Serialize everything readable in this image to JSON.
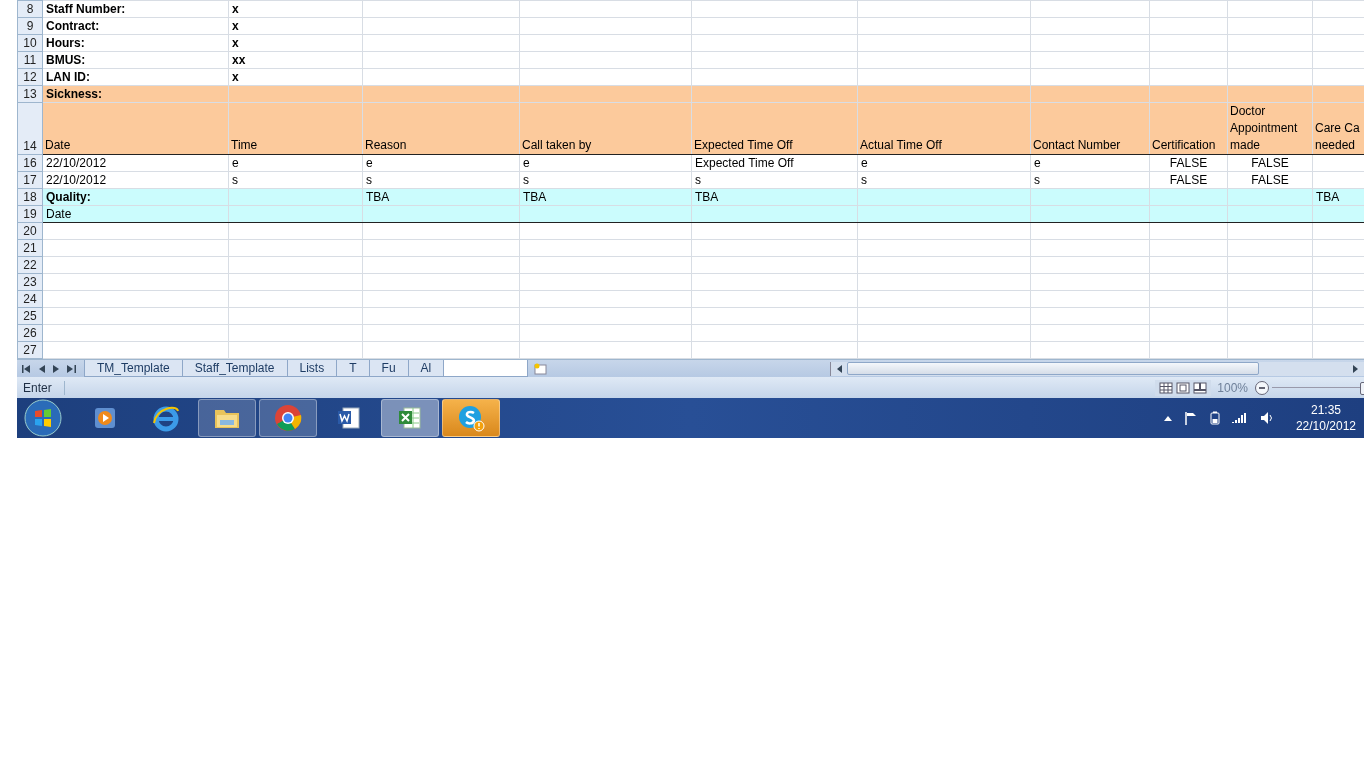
{
  "rows": [
    {
      "number": "8",
      "kind": "info",
      "cells": [
        "Staff Number:",
        "x"
      ]
    },
    {
      "number": "9",
      "kind": "info",
      "cells": [
        "Contract:",
        "x"
      ]
    },
    {
      "number": "10",
      "kind": "info",
      "cells": [
        "Hours:",
        "x"
      ]
    },
    {
      "number": "11",
      "kind": "info",
      "cells": [
        "BMUS:",
        "xx"
      ]
    },
    {
      "number": "12",
      "kind": "info",
      "cells": [
        "LAN ID:",
        "x"
      ]
    },
    {
      "number": "13",
      "kind": "section",
      "color": "#fcca9c",
      "cells": [
        "Sickness:"
      ]
    },
    {
      "number": "14",
      "kind": "header",
      "color": "#fcca9c",
      "cells": [
        "Date",
        "Time",
        "Reason",
        "Call taken by",
        "Expected Time Off",
        "Actual Time Off",
        "Contact Number",
        "Certification",
        "Doctor Appointment made",
        "Care Ca needed"
      ]
    },
    {
      "number": "16",
      "kind": "data",
      "cells": [
        "22/10/2012",
        "e",
        "e",
        "e",
        "Expected Time Off",
        "e",
        "e",
        "FALSE",
        "FALSE"
      ]
    },
    {
      "number": "17",
      "kind": "data",
      "cells": [
        "22/10/2012",
        "s",
        "s",
        "s",
        "s",
        "s",
        "s",
        "FALSE",
        "FALSE"
      ]
    },
    {
      "number": "18",
      "kind": "section",
      "color": "#cbfcfd",
      "cells": [
        "Quality:",
        null,
        "TBA",
        "TBA",
        "TBA",
        null,
        null,
        null,
        null,
        "TBA"
      ]
    },
    {
      "number": "19",
      "kind": "data",
      "color": "#cbfcfd",
      "cells": [
        "Date"
      ]
    },
    {
      "number": "20",
      "kind": "data"
    },
    {
      "number": "21",
      "kind": "data"
    },
    {
      "number": "22",
      "kind": "data"
    },
    {
      "number": "23",
      "kind": "data"
    },
    {
      "number": "24",
      "kind": "data"
    },
    {
      "number": "25",
      "kind": "data"
    },
    {
      "number": "26",
      "kind": "data"
    },
    {
      "number": "27",
      "kind": "data"
    }
  ],
  "sheet_tabs": [
    {
      "label": "TM_Template",
      "selected": false
    },
    {
      "label": "Staff_Template",
      "selected": false
    },
    {
      "label": "Lists",
      "selected": false
    },
    {
      "label": "T",
      "selected": false
    },
    {
      "label": "Fu",
      "selected": false
    },
    {
      "label": "Al",
      "selected": false
    },
    {
      "selected": true
    }
  ],
  "status_bar": {
    "mode": "Enter",
    "zoom": "100%",
    "zoom_slider": {
      "level": 1
    }
  },
  "taskbar": {
    "items": [
      {
        "kind": "media",
        "running": false,
        "selected": false
      },
      {
        "kind": "browser-e",
        "running": false,
        "selected": false
      },
      {
        "kind": "folder",
        "running": true,
        "selected": false
      },
      {
        "kind": "browser-ring",
        "running": true,
        "selected": false
      },
      {
        "kind": "word",
        "running": false,
        "selected": false
      },
      {
        "kind": "excel",
        "running": true,
        "selected": true
      },
      {
        "kind": "chat",
        "running": true,
        "selected": false,
        "attention": true
      }
    ],
    "clock": {
      "time": "21:35",
      "date": "22/10/2012"
    }
  }
}
